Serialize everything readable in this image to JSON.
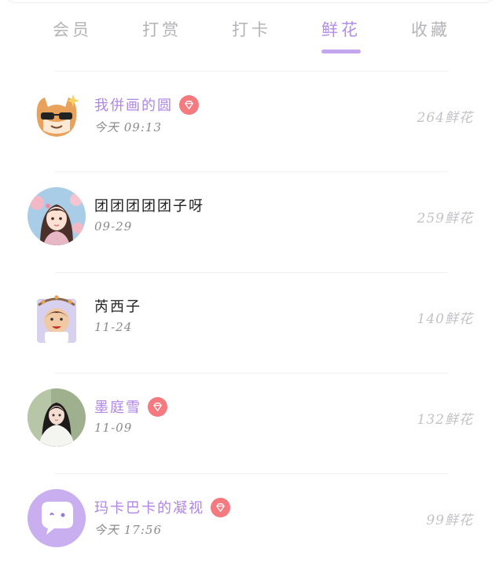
{
  "tabs": [
    {
      "label": "会员",
      "active": false
    },
    {
      "label": "打赏",
      "active": false
    },
    {
      "label": "打卡",
      "active": false
    },
    {
      "label": "鲜花",
      "active": true
    },
    {
      "label": "收藏",
      "active": false
    }
  ],
  "colors": {
    "accent": "#b28ee8",
    "underline": "#c4a6ee",
    "vip_badge": "#f47a7f",
    "vip_name": "#b085e6",
    "muted": "#c3c3c7"
  },
  "records": [
    {
      "name": "我併画的圆",
      "time": "今天  09:13",
      "flowers": "264鲜花",
      "vip": true,
      "avatar_icon": "cartoon-cat-sunglasses-icon"
    },
    {
      "name": "团团团团团子呀",
      "time": "09-29",
      "flowers": "259鲜花",
      "vip": false,
      "avatar_icon": "girl-portrait-icon"
    },
    {
      "name": "芮西子",
      "time": "11-24",
      "flowers": "140鲜花",
      "vip": false,
      "avatar_icon": "cartoon-kid-icon"
    },
    {
      "name": "墨庭雪",
      "time": "11-09",
      "flowers": "132鲜花",
      "vip": true,
      "avatar_icon": "woman-portrait-icon"
    },
    {
      "name": "玛卡巴卡的凝视",
      "time": "今天  17:56",
      "flowers": "99鲜花",
      "vip": true,
      "avatar_icon": "chat-bubble-icon"
    }
  ]
}
